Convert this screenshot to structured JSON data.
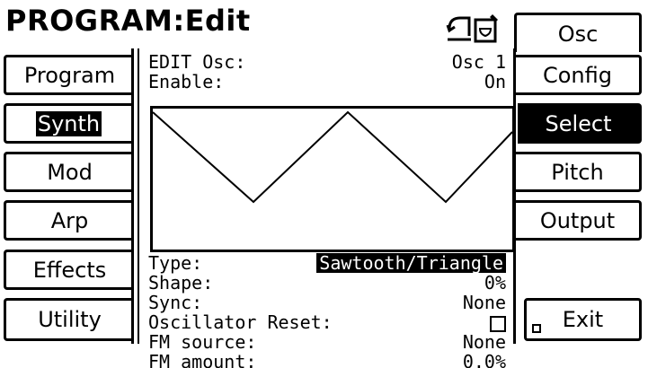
{
  "header": {
    "title": "PROGRAM:Edit"
  },
  "left_tabs": [
    {
      "label": "Program"
    },
    {
      "label": "Synth"
    },
    {
      "label": "Mod"
    },
    {
      "label": "Arp"
    },
    {
      "label": "Effects"
    },
    {
      "label": "Utility"
    }
  ],
  "right_tabs": [
    {
      "label": "Osc"
    },
    {
      "label": "Config"
    },
    {
      "label": "Select"
    },
    {
      "label": "Pitch"
    },
    {
      "label": "Output"
    },
    {
      "label": "Exit"
    }
  ],
  "panel": {
    "edit_label": "EDIT Osc:",
    "edit_value": "Osc 1",
    "enable_label": "Enable:",
    "enable_value": "On",
    "params": [
      {
        "label": "Type:",
        "value": "Sawtooth/Triangle"
      },
      {
        "label": "Shape:",
        "value": "0%"
      },
      {
        "label": "Sync:",
        "value": "None"
      },
      {
        "label": "Oscillator Reset:",
        "value": ""
      },
      {
        "label": "FM source:",
        "value": "None"
      },
      {
        "label": "FM amount:",
        "value": "0.0%"
      }
    ]
  },
  "icons": [
    "undo-icon",
    "edit-document-icon",
    "checkbox-icon"
  ]
}
